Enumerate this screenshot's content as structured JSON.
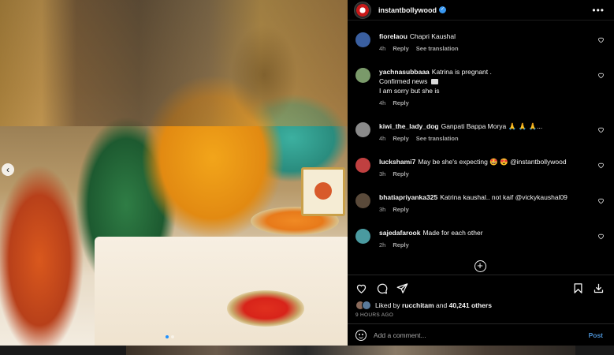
{
  "post": {
    "username": "instantbollywood",
    "verified": true,
    "media": {
      "carousel_position": 1,
      "carousel_count": 2
    }
  },
  "comments": [
    {
      "user": "fiorelaou",
      "text": "Chapri Kaushal",
      "age": "4h",
      "reply": "Reply",
      "translate": "See translation",
      "avatar_color": "#3a5fa0"
    },
    {
      "user": "yachnasubbaaa",
      "text_lines": [
        "Katrina is pregnant .",
        "Confirmed news",
        "I am sorry but she is"
      ],
      "age": "4h",
      "reply": "Reply",
      "avatar_color": "#7a9a6a"
    },
    {
      "user": "kiwi_the_lady_dog",
      "text": "Ganpati Bappa Morya 🙏 🙏 🙏...",
      "age": "4h",
      "reply": "Reply",
      "translate": "See translation",
      "avatar_color": "#8a8a8a"
    },
    {
      "user": "luckshami7",
      "text": "May be she's expecting 🤩 😍 @instantbollywood",
      "age": "3h",
      "reply": "Reply",
      "avatar_color": "#c04040"
    },
    {
      "user": "bhatiapriyanka325",
      "text": "Katrina kaushal.. not kaif @vickykaushal09",
      "age": "3h",
      "reply": "Reply",
      "avatar_color": "#5a4a3a"
    },
    {
      "user": "sajedafarook",
      "text": "Made for each other",
      "age": "2h",
      "reply": "Reply",
      "avatar_color": "#4a9aa0"
    }
  ],
  "load_more": "+",
  "likes": {
    "prefix": "Liked by",
    "user": "rucchitam",
    "connector": "and",
    "count": "40,241 others"
  },
  "timestamp": "9 HOURS AGO",
  "add_comment": {
    "placeholder": "Add a comment...",
    "post_label": "Post"
  },
  "colors": {
    "panel_bg": "#000000",
    "link_blue": "#4a8fd0",
    "muted": "#a8a8a8"
  },
  "icons": [
    "instagram-avatar-icon",
    "verified-badge-icon",
    "more-options-icon",
    "heart-icon",
    "comment-icon",
    "share-icon",
    "save-icon",
    "download-icon",
    "emoji-icon",
    "add-circle-icon",
    "carousel-prev-icon"
  ]
}
